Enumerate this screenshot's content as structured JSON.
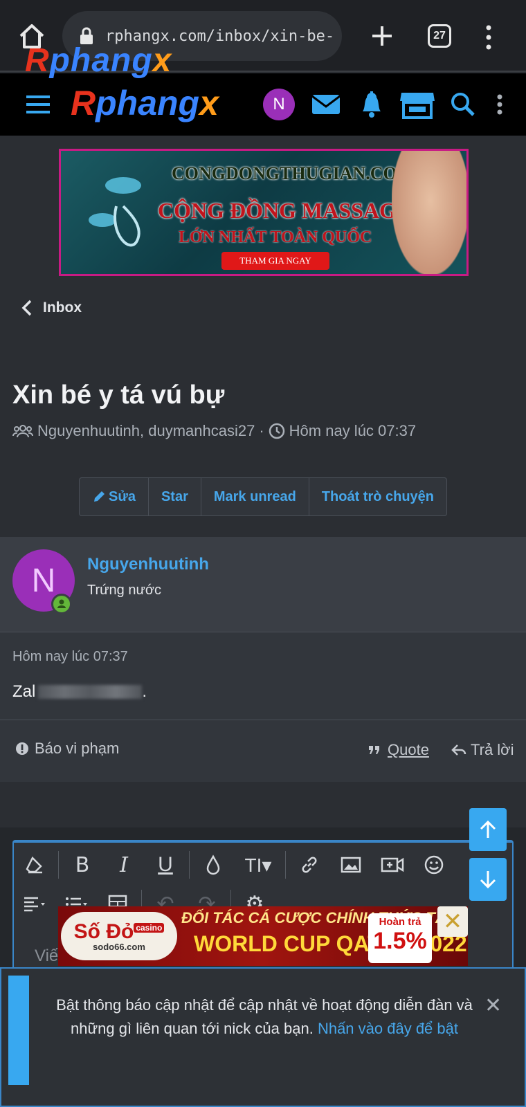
{
  "browser": {
    "url": "rphangx.com/inbox/xin-be-y-t",
    "tab_count": "27"
  },
  "site": {
    "logo_parts": [
      "R",
      "phang",
      "x"
    ],
    "avatar_letter": "N"
  },
  "banner_top": {
    "line1": "CONGDONGTHUGIAN.COM",
    "line2": "CỘNG ĐỒNG MASSAGE",
    "line3": "LỚN NHẤT TOÀN QUỐC",
    "cta": "THAM GIA NGAY"
  },
  "nav": {
    "back_label": "Inbox"
  },
  "conversation": {
    "title": "Xin bé y tá vú bự",
    "participants": "Nguyenhuutinh, duymanhcasi27",
    "separator": "·",
    "time": "Hôm nay lúc 07:37"
  },
  "actions": {
    "edit": "Sửa",
    "star": "Star",
    "mark_unread": "Mark unread",
    "leave": "Thoát trò chuyện"
  },
  "message": {
    "avatar_letter": "N",
    "username": "Nguyenhuutinh",
    "user_title": "Trứng nước",
    "timestamp": "Hôm nay lúc 07:37",
    "body_visible": "Zal",
    "body_end": ".",
    "report": "Báo vi phạm",
    "quote": "Quote",
    "reply": "Trả lời"
  },
  "editor": {
    "placeholder": "Viế"
  },
  "banner_bottom": {
    "brand": "Số Đỏ",
    "tag": "casino",
    "site": "sodo66.com",
    "line1": "ĐỐI TÁC CÁ CƯỢC CHÍNH THỨC TẠI",
    "line2": "WORLD CUP QATAR 2022",
    "badge_top": "Hoàn trả",
    "badge_pct": "1.5%"
  },
  "notice": {
    "text": "Bật thông báo cập nhật để cập nhật về hoạt động diễn đàn và những gì liên quan tới nick của bạn.",
    "link": "Nhấn vào đây để bật",
    "close": "✕"
  },
  "colors": {
    "accent": "#47a7eb",
    "avatar": "#9a2fb8",
    "online": "#63b73a",
    "scroll_button": "#38a8f0"
  }
}
